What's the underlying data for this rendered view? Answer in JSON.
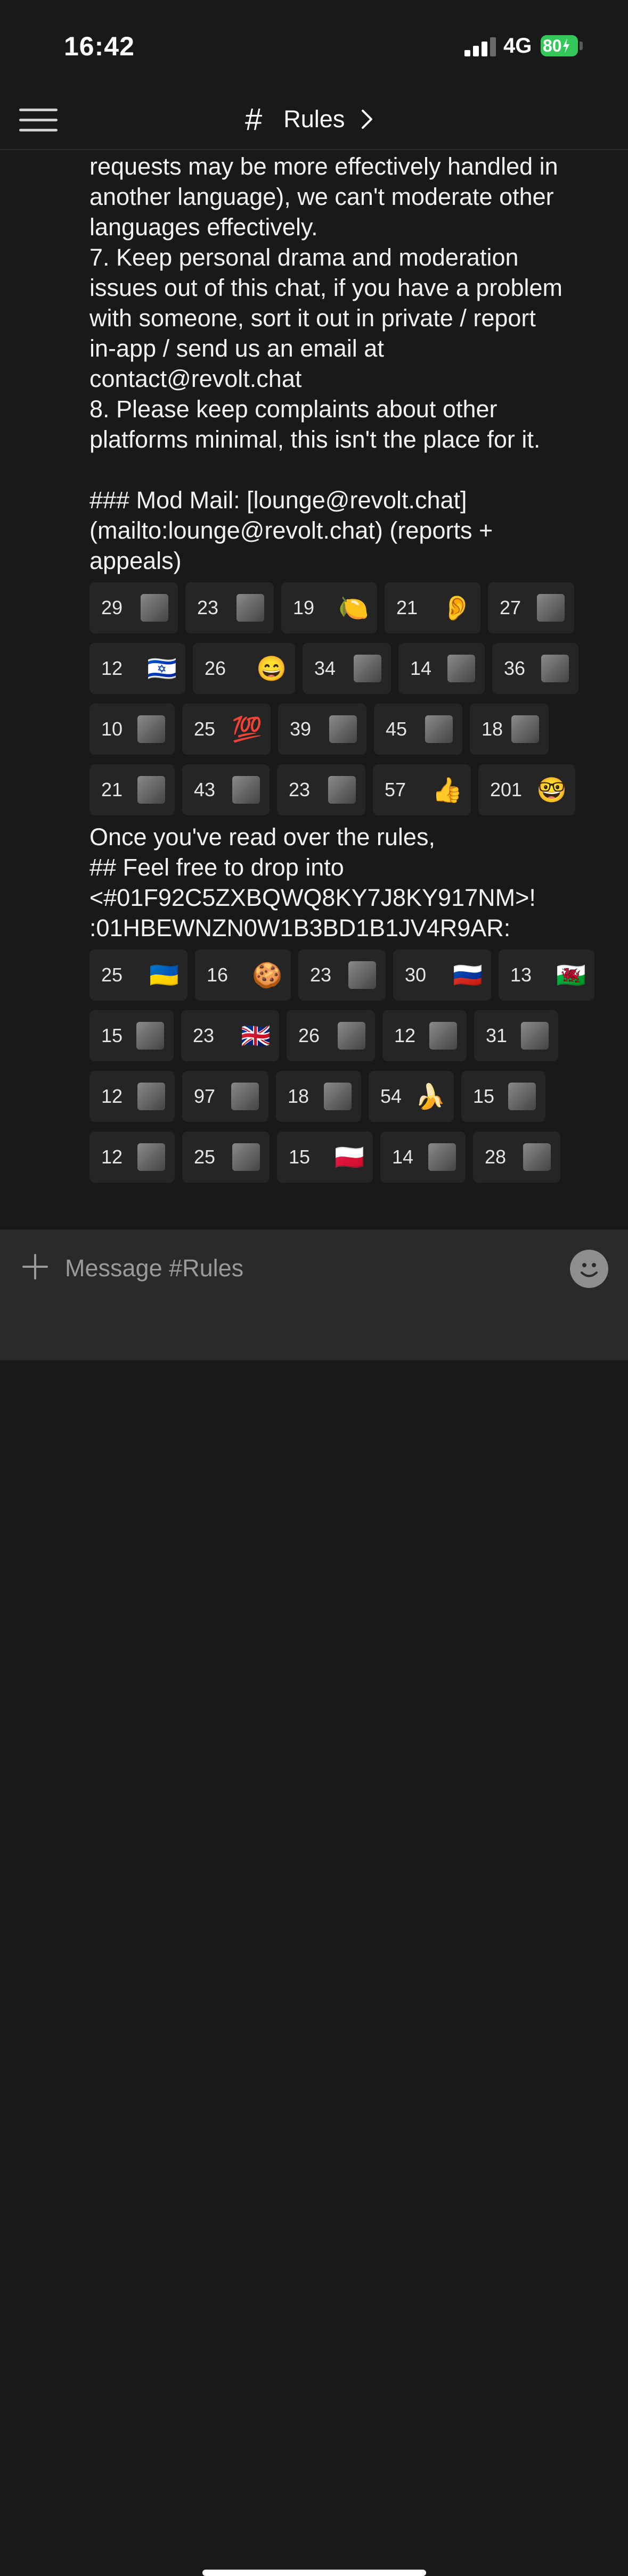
{
  "status_bar": {
    "time": "16:42",
    "network": "4G",
    "battery": "80"
  },
  "header": {
    "channel_name": "Rules"
  },
  "message_1": {
    "text": "requests may be more effectively handled in\nanother language), we can't moderate other\nlanguages effectively.\n7. Keep personal drama and moderation\nissues out of this chat, if you have a problem\nwith someone, sort it out in private / report\nin-app / send us an email at\ncontact@revolt.chat\n8. Please keep complaints about other\nplatforms minimal, this isn't the place for it.\n\n### Mod Mail: [lounge@revolt.chat]\n(mailto:lounge@revolt.chat) (reports +\nappeals)"
  },
  "reactions_1": [
    [
      {
        "count": "29",
        "icon": "custom-emoji-icon",
        "glyph": "",
        "img": true,
        "w": 166
      },
      {
        "count": "23",
        "icon": "custom-emoji-icon",
        "glyph": "",
        "img": true,
        "w": 166
      },
      {
        "count": "19",
        "icon": "lemon-icon",
        "glyph": "🍋",
        "img": false,
        "w": 180
      },
      {
        "count": "21",
        "icon": "ear-icon",
        "glyph": "👂",
        "img": false,
        "w": 180
      },
      {
        "count": "27",
        "icon": "custom-emoji-icon",
        "glyph": "",
        "img": true,
        "w": 162
      }
    ],
    [
      {
        "count": "12",
        "icon": "israel-flag-icon",
        "glyph": "🇮🇱",
        "img": false,
        "w": 180
      },
      {
        "count": "26",
        "icon": "grinning-face-icon",
        "glyph": "😄",
        "img": false,
        "w": 192
      },
      {
        "count": "34",
        "icon": "custom-emoji-icon",
        "glyph": "",
        "img": true,
        "w": 166
      },
      {
        "count": "14",
        "icon": "custom-emoji-icon",
        "glyph": "",
        "img": true,
        "w": 162
      },
      {
        "count": "36",
        "icon": "custom-emoji-icon",
        "glyph": "",
        "img": true,
        "w": 162
      }
    ],
    [
      {
        "count": "10",
        "icon": "custom-emoji-icon",
        "glyph": "",
        "img": true,
        "w": 160
      },
      {
        "count": "25",
        "icon": "hundred-points-icon",
        "glyph": "💯",
        "img": false,
        "w": 166
      },
      {
        "count": "39",
        "icon": "custom-emoji-icon",
        "glyph": "",
        "img": true,
        "w": 166
      },
      {
        "count": "45",
        "icon": "custom-emoji-icon",
        "glyph": "",
        "img": true,
        "w": 166
      },
      {
        "count": "18",
        "icon": "custom-emoji-icon",
        "glyph": "",
        "img": true,
        "w": 148
      }
    ],
    [
      {
        "count": "21",
        "icon": "custom-emoji-icon",
        "glyph": "",
        "img": true,
        "w": 160
      },
      {
        "count": "43",
        "icon": "custom-emoji-icon",
        "glyph": "",
        "img": true,
        "w": 164
      },
      {
        "count": "23",
        "icon": "custom-emoji-icon",
        "glyph": "",
        "img": true,
        "w": 166
      },
      {
        "count": "57",
        "icon": "thumbs-up-icon",
        "glyph": "👍",
        "img": false,
        "w": 184
      },
      {
        "count": "201",
        "icon": "nerd-face-icon",
        "glyph": "🤓",
        "img": false,
        "w": 182
      }
    ]
  ],
  "message_2": {
    "text": "Once you've read over the rules,\n## Feel free to drop into\n<#01F92C5ZXBQWQ8KY7J8KY917NM>!\n:01HBEWNZN0W1B3BD1B1JV4R9AR:"
  },
  "reactions_2": [
    [
      {
        "count": "25",
        "icon": "ukraine-flag-icon",
        "glyph": "🇺🇦",
        "img": false,
        "w": 184
      },
      {
        "count": "16",
        "icon": "cookie-icon",
        "glyph": "🍪",
        "img": false,
        "w": 180
      },
      {
        "count": "23",
        "icon": "custom-emoji-icon",
        "glyph": "",
        "img": true,
        "w": 164
      },
      {
        "count": "30",
        "icon": "russia-flag-icon",
        "glyph": "🇷🇺",
        "img": false,
        "w": 184
      },
      {
        "count": "13",
        "icon": "wales-flag-icon",
        "glyph": "🏴󠁧󠁢󠁷󠁬󠁳󠁿",
        "img": false,
        "w": 180
      }
    ],
    [
      {
        "count": "15",
        "icon": "custom-emoji-icon",
        "glyph": "",
        "img": true,
        "w": 158
      },
      {
        "count": "23",
        "icon": "uk-flag-icon",
        "glyph": "🇬🇧",
        "img": false,
        "w": 184
      },
      {
        "count": "26",
        "icon": "custom-emoji-icon",
        "glyph": "",
        "img": true,
        "w": 166
      },
      {
        "count": "12",
        "icon": "custom-emoji-icon",
        "glyph": "",
        "img": true,
        "w": 158
      },
      {
        "count": "31",
        "icon": "custom-emoji-icon",
        "glyph": "",
        "img": true,
        "w": 158
      }
    ],
    [
      {
        "count": "12",
        "icon": "custom-emoji-icon",
        "glyph": "",
        "img": true,
        "w": 160
      },
      {
        "count": "97",
        "icon": "custom-emoji-icon",
        "glyph": "",
        "img": true,
        "w": 162
      },
      {
        "count": "18",
        "icon": "custom-emoji-icon",
        "glyph": "",
        "img": true,
        "w": 160
      },
      {
        "count": "54",
        "icon": "banana-icon",
        "glyph": "🍌",
        "img": false,
        "w": 160
      },
      {
        "count": "15",
        "icon": "custom-emoji-icon",
        "glyph": "",
        "img": true,
        "w": 158
      }
    ],
    [
      {
        "count": "12",
        "icon": "custom-emoji-icon",
        "glyph": "",
        "img": true,
        "w": 160
      },
      {
        "count": "25",
        "icon": "custom-emoji-icon",
        "glyph": "",
        "img": true,
        "w": 164
      },
      {
        "count": "15",
        "icon": "poland-flag-icon",
        "glyph": "🇵🇱",
        "img": false,
        "w": 180
      },
      {
        "count": "14",
        "icon": "custom-emoji-icon",
        "glyph": "",
        "img": true,
        "w": 160
      },
      {
        "count": "28",
        "icon": "custom-emoji-icon",
        "glyph": "",
        "img": true,
        "w": 164
      }
    ]
  ],
  "composer": {
    "placeholder": "Message #Rules"
  }
}
